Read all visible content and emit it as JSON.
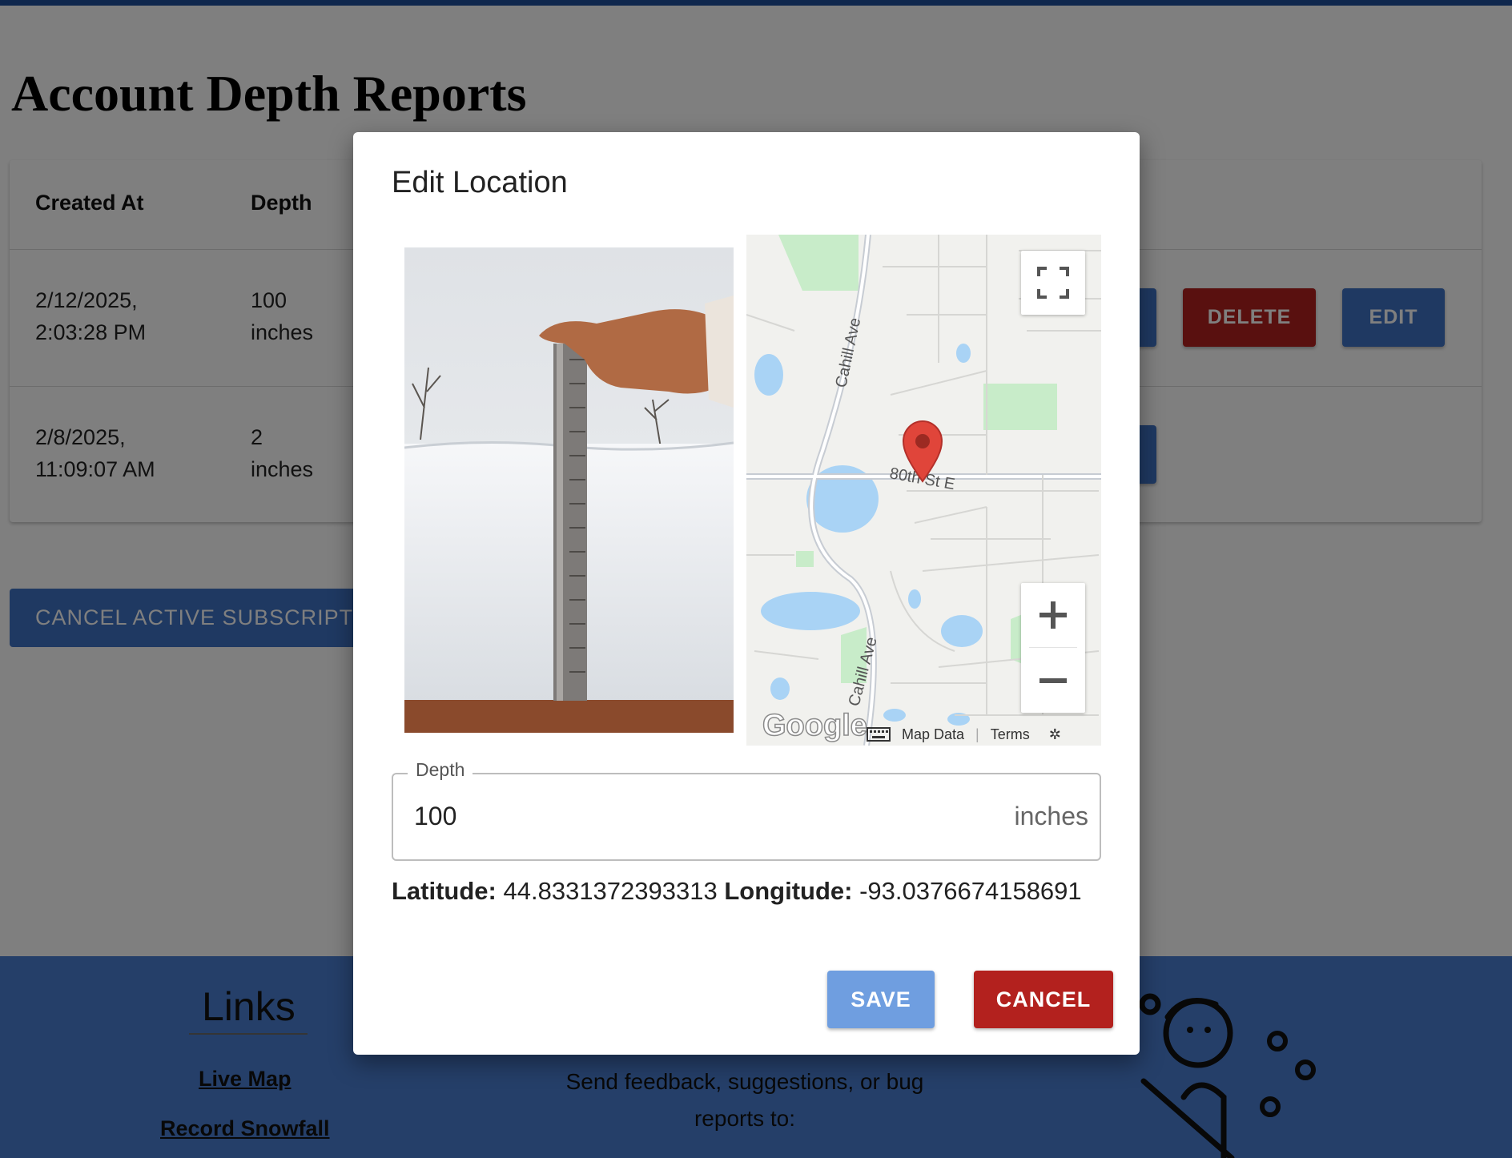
{
  "page": {
    "title": "Account Depth Reports",
    "table": {
      "headers": [
        "Created At",
        "Depth"
      ],
      "rows": [
        {
          "created_line1": "2/12/2025,",
          "created_line2": "2:03:28 PM",
          "depth_line1": "100",
          "depth_line2": "inches"
        },
        {
          "created_line1": "2/8/2025,",
          "created_line2": "11:09:07 AM",
          "depth_line1": "2",
          "depth_line2": "inches"
        }
      ],
      "delete_label": "DELETE",
      "edit_label": "EDIT"
    },
    "cancel_subscription_label": "CANCEL ACTIVE SUBSCRIPTION"
  },
  "footer": {
    "links_title": "Links",
    "links": [
      "Live Map",
      "Record Snowfall"
    ],
    "feedback_text": "Send feedback, suggestions, or bug reports to:"
  },
  "dialog": {
    "title": "Edit Location",
    "map": {
      "street_labels": [
        "Cahill Ave",
        "80th St E",
        "Cahill Ave"
      ],
      "attribution": [
        "Map Data",
        "Terms"
      ],
      "logo": "Google"
    },
    "depth": {
      "label": "Depth",
      "value": "100",
      "unit": "inches"
    },
    "latitude_label": "Latitude:",
    "latitude_value": "44.8331372393313",
    "longitude_label": "Longitude:",
    "longitude_value": "-93.0376674158691",
    "save_label": "SAVE",
    "cancel_label": "CANCEL"
  },
  "colors": {
    "primary": "#3f72c4",
    "danger": "#b3211e",
    "footer": "#4a7fd2",
    "save_disabled": "#6f9ee0"
  }
}
